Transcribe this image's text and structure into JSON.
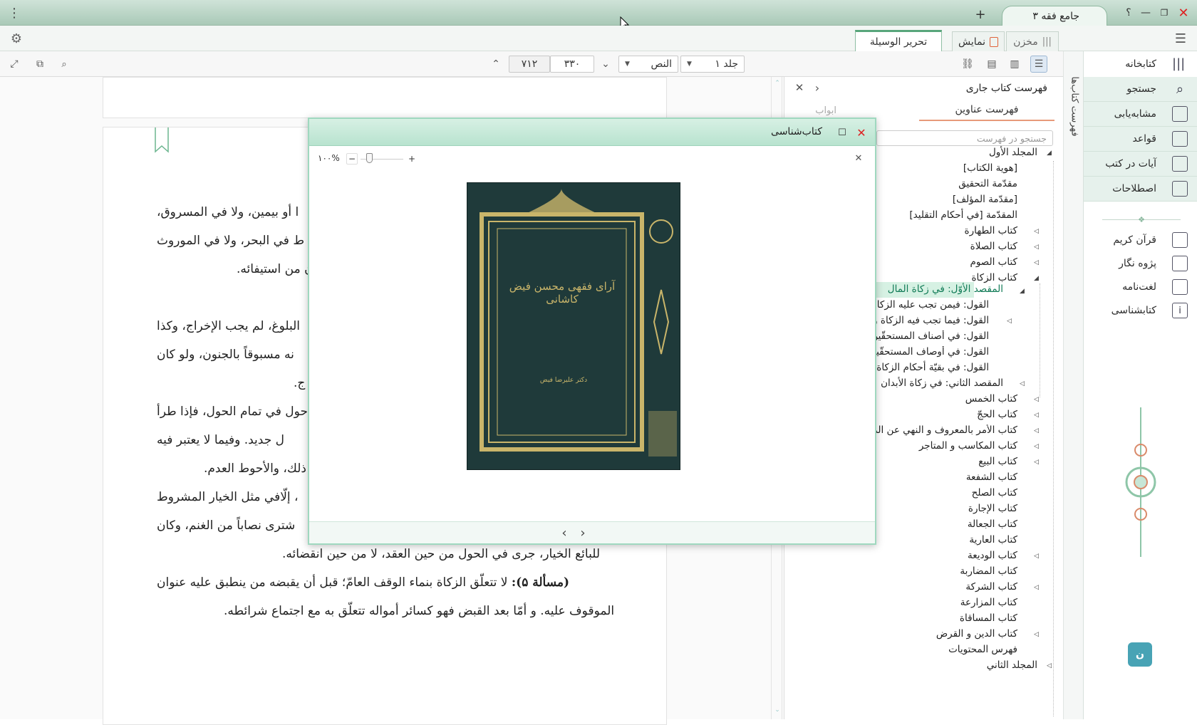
{
  "title_bar": {
    "app_tab": "جامع فقه ۳",
    "new_tab": "+",
    "help": "؟"
  },
  "tab_bar": {
    "tabs": [
      "مخزن",
      "نمایش",
      "تحریر الوسیلة"
    ]
  },
  "toolbar": {
    "volume_select": "جلد ۱",
    "view_select": "النص",
    "page_current": "۳۳۰",
    "page_total": "۷۱۲"
  },
  "sidebar": {
    "vertical_label": "فهرست کتاب‌ها",
    "top_item": "کتابخانه",
    "items": [
      "جستجو",
      "مشابه‌یابی",
      "قواعد",
      "آیات در کتب",
      "اصطلاحات"
    ],
    "tools": [
      "قرآن کریم",
      "پژوه نگار",
      "لغت‌نامه",
      "کتابشناسی"
    ]
  },
  "toc": {
    "header": "فهرست کتاب جاری",
    "tab_titles": "فهرست عناوین",
    "tab_chapters": "ابواب",
    "search_placeholder": "جستجو در فهرست",
    "items": [
      "المجلد الأول",
      "[هوية الكتاب]",
      "مقدّمة التحقيق",
      "[مقدّمة المؤلف]",
      "المقدّمة [في أحكام التقليد]",
      "كتاب الطهارة",
      "كتاب الصلاة",
      "كتاب الصوم",
      "كتاب الزكاة",
      "المقصد الأوّل: في زكاة المال",
      "القول: فيمن تجب عليه الزكاة",
      "القول: فيما تجب فيه الزكاة وما",
      "القول: في أصناف المستحقّين ل",
      "القول: في أوصاف المستحقّين ل",
      "القول: في بقيّة أحكام الزكاة",
      "المقصد الثاني: في زكاة الأبدان",
      "كتاب الخمس",
      "كتاب الحجّ",
      "كتاب الأمر بالمعروف و النهي عن المنك",
      "كتاب المكاسب و المتاجر",
      "كتاب البيع",
      "كتاب الشفعة",
      "كتاب الصلح",
      "كتاب الإجارة",
      "كتاب الجعالة",
      "كتاب العارية",
      "كتاب الوديعة",
      "كتاب المضاربة",
      "كتاب الشركة",
      "كتاب المزارعة",
      "كتاب المساقاة",
      "كتاب الدين و القرض",
      "فهرس المحتويات",
      "المجلد الثاني"
    ]
  },
  "text": {
    "lines": [
      "ا أو بيمين، ولا في المسروق،",
      "ط في البحر، ولا في الموروث",
      "ن من استيفائه.",
      "البلوغ، لم يجب الإخراج، وكذا",
      "نه مسبوقاً بالجنون، ولو كان",
      "ج.",
      "حول في تمام الحول، فإذا طرأ",
      "ل جديد. وفيما لا يعتبر فيه",
      "ذلك، والأحوط العدم.",
      "، إلّافي مثل الخيار المشروط",
      "شترى نصاباً من الغنم، وكان",
      "للبائع الخيار، جرى في الحول من حين العقد، لا من حين انقضائه.",
      "لا تتعلّق الزكاة بنماء الوقف العامّ؛ قبل أن يقبضه من ينطبق عليه عنوان",
      "الموقوف عليه. و أمّا بعد القبض فهو كسائر أمواله تتعلّق به مع اجتماع شرائطه."
    ],
    "mas_label": "(مسألة ۵):"
  },
  "dialog": {
    "title": "کتاب‌شناسی",
    "zoom": "۱۰۰%",
    "cover_title": "آرای فقهی محسن فیض کاشانی",
    "cover_author": "دکتر علیرضا فیض",
    "colors": {
      "accent": "#9fd8bf",
      "cover": "#1f3a3a",
      "gold": "#c9b56a"
    }
  }
}
